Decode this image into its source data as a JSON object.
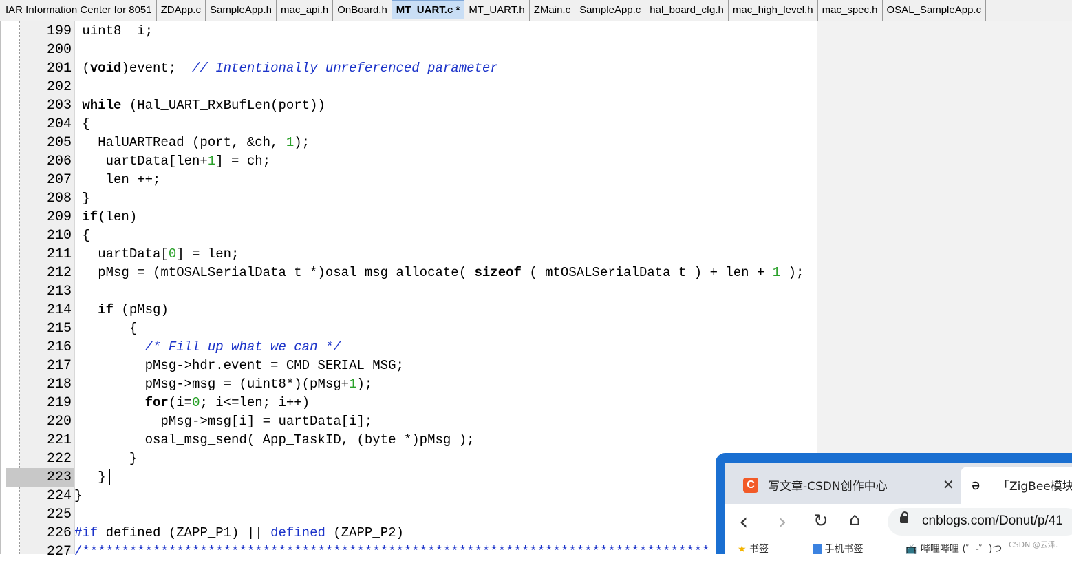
{
  "tabs": [
    {
      "label": "IAR Information Center for 8051",
      "active": false
    },
    {
      "label": "ZDApp.c",
      "active": false
    },
    {
      "label": "SampleApp.h",
      "active": false
    },
    {
      "label": "mac_api.h",
      "active": false
    },
    {
      "label": "OnBoard.h",
      "active": false
    },
    {
      "label": "MT_UART.c *",
      "active": true
    },
    {
      "label": "MT_UART.h",
      "active": false
    },
    {
      "label": "ZMain.c",
      "active": false
    },
    {
      "label": "SampleApp.c",
      "active": false
    },
    {
      "label": "hal_board_cfg.h",
      "active": false
    },
    {
      "label": "mac_high_level.h",
      "active": false
    },
    {
      "label": "mac_spec.h",
      "active": false
    },
    {
      "label": "OSAL_SampleApp.c",
      "active": false
    }
  ],
  "editor": {
    "current_line": "223",
    "lines": [
      {
        "n": "199",
        "code": [
          {
            "t": " uint8  i;",
            "c": ""
          }
        ]
      },
      {
        "n": "200",
        "code": []
      },
      {
        "n": "201",
        "code": [
          {
            "t": " (",
            "c": ""
          },
          {
            "t": "void",
            "c": "kw"
          },
          {
            "t": ")event;  ",
            "c": ""
          },
          {
            "t": "// Intentionally unreferenced parameter",
            "c": "cm"
          }
        ]
      },
      {
        "n": "202",
        "code": []
      },
      {
        "n": "203",
        "code": [
          {
            "t": " ",
            "c": ""
          },
          {
            "t": "while",
            "c": "kw"
          },
          {
            "t": " (Hal_UART_RxBufLen(port))",
            "c": ""
          }
        ]
      },
      {
        "n": "204",
        "code": [
          {
            "t": " {",
            "c": ""
          }
        ]
      },
      {
        "n": "205",
        "code": [
          {
            "t": "   HalUARTRead (port, &ch, ",
            "c": ""
          },
          {
            "t": "1",
            "c": "num"
          },
          {
            "t": ");",
            "c": ""
          }
        ]
      },
      {
        "n": "206",
        "code": [
          {
            "t": "    uartData[len+",
            "c": ""
          },
          {
            "t": "1",
            "c": "num"
          },
          {
            "t": "] = ch;",
            "c": ""
          }
        ]
      },
      {
        "n": "207",
        "code": [
          {
            "t": "    len ++;",
            "c": ""
          }
        ]
      },
      {
        "n": "208",
        "code": [
          {
            "t": " }",
            "c": ""
          }
        ]
      },
      {
        "n": "209",
        "code": [
          {
            "t": " ",
            "c": ""
          },
          {
            "t": "if",
            "c": "kw"
          },
          {
            "t": "(len)",
            "c": ""
          }
        ]
      },
      {
        "n": "210",
        "code": [
          {
            "t": " {",
            "c": ""
          }
        ]
      },
      {
        "n": "211",
        "code": [
          {
            "t": "   uartData[",
            "c": ""
          },
          {
            "t": "0",
            "c": "num"
          },
          {
            "t": "] = len;",
            "c": ""
          }
        ]
      },
      {
        "n": "212",
        "code": [
          {
            "t": "   pMsg = (mtOSALSerialData_t *)osal_msg_allocate( ",
            "c": ""
          },
          {
            "t": "sizeof",
            "c": "kw"
          },
          {
            "t": " ( mtOSALSerialData_t ) + len + ",
            "c": ""
          },
          {
            "t": "1",
            "c": "num"
          },
          {
            "t": " );",
            "c": ""
          }
        ]
      },
      {
        "n": "213",
        "code": []
      },
      {
        "n": "214",
        "code": [
          {
            "t": "   ",
            "c": ""
          },
          {
            "t": "if",
            "c": "kw"
          },
          {
            "t": " (pMsg)",
            "c": ""
          }
        ]
      },
      {
        "n": "215",
        "code": [
          {
            "t": "       {",
            "c": ""
          }
        ]
      },
      {
        "n": "216",
        "code": [
          {
            "t": "         ",
            "c": ""
          },
          {
            "t": "/* Fill up what we can */",
            "c": "cm"
          }
        ]
      },
      {
        "n": "217",
        "code": [
          {
            "t": "         pMsg->hdr.event = CMD_SERIAL_MSG;",
            "c": ""
          }
        ]
      },
      {
        "n": "218",
        "code": [
          {
            "t": "         pMsg->msg = (uint8*)(pMsg+",
            "c": ""
          },
          {
            "t": "1",
            "c": "num"
          },
          {
            "t": ");",
            "c": ""
          }
        ]
      },
      {
        "n": "219",
        "code": [
          {
            "t": "         ",
            "c": ""
          },
          {
            "t": "for",
            "c": "kw"
          },
          {
            "t": "(i=",
            "c": ""
          },
          {
            "t": "0",
            "c": "num"
          },
          {
            "t": "; i<=len; i++)",
            "c": ""
          }
        ]
      },
      {
        "n": "220",
        "code": [
          {
            "t": "           pMsg->msg[i] = uartData[i];",
            "c": ""
          }
        ]
      },
      {
        "n": "221",
        "code": [
          {
            "t": "         osal_msg_send( App_TaskID, (byte *)pMsg );",
            "c": ""
          }
        ]
      },
      {
        "n": "222",
        "code": [
          {
            "t": "       }",
            "c": ""
          }
        ]
      },
      {
        "n": "223",
        "code": [
          {
            "t": "   }",
            "c": ""
          }
        ]
      },
      {
        "n": "224",
        "code": [
          {
            "t": "}",
            "c": ""
          }
        ]
      },
      {
        "n": "225",
        "code": []
      },
      {
        "n": "226",
        "code": [
          {
            "t": "#if",
            "c": "pp"
          },
          {
            "t": " defined (ZAPP_P1) || ",
            "c": ""
          },
          {
            "t": "defined",
            "c": "pp"
          },
          {
            "t": " (ZAPP_P2)",
            "c": ""
          }
        ]
      },
      {
        "n": "227",
        "code": [
          {
            "t": "/********************************************************************************",
            "c": "pp"
          }
        ]
      }
    ]
  },
  "browser": {
    "tab1_title": "写文章-CSDN创作中心",
    "tab1_favicon": "C",
    "tab1_close": "✕",
    "tab2_title": "「ZigBee模块",
    "tab2_icon": "cnblogs-icon",
    "nav_back": "‹",
    "nav_forward": "›",
    "nav_reload": "↻",
    "nav_home": "⌂",
    "url": "cnblogs.com/Donut/p/41",
    "bookmarks": [
      "书签",
      "手机书签",
      "哔哩哔哩 (゜-゜)つ"
    ]
  },
  "watermark": "CSDN @云泽."
}
